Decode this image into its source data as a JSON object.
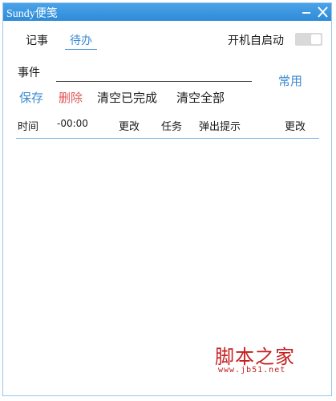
{
  "window": {
    "title": "Sundy便笺"
  },
  "tabs": {
    "notes": "记事",
    "todo": "待办"
  },
  "autostart": {
    "label": "开机自启动",
    "enabled": false
  },
  "event": {
    "label": "事件",
    "value": ""
  },
  "buttons": {
    "common": "常用",
    "save": "保存",
    "delete": "删除",
    "clear_done": "清空已完成",
    "clear_all": "清空全部"
  },
  "header": {
    "time": "时间",
    "time_value": "-00:00",
    "change": "更改",
    "task": "任务",
    "popup": "弹出提示",
    "change2": "更改"
  },
  "watermark": {
    "name": "脚本之家",
    "url": "www.jb51.net"
  },
  "colors": {
    "titlebar": "#3a94dd",
    "accent": "#3a8ad0",
    "danger": "#e05353",
    "watermark": "#c62020"
  }
}
